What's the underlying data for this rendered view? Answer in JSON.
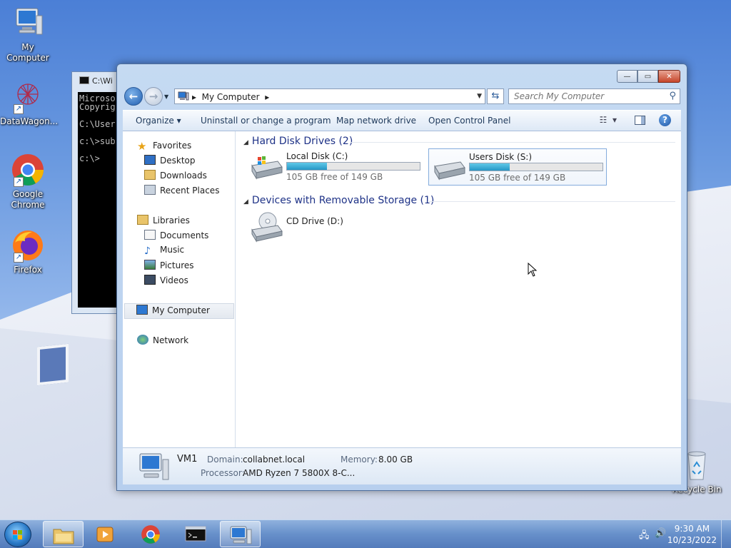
{
  "desktop": {
    "icons": [
      {
        "label": "My Computer",
        "icon": "computer-icon"
      },
      {
        "label": "DataWagon...",
        "icon": "datawagon-icon"
      },
      {
        "label": "Google Chrome",
        "icon": "chrome-icon"
      },
      {
        "label": "Firefox",
        "icon": "firefox-icon"
      },
      {
        "label": "Recycle Bin",
        "icon": "recycle-bin-icon"
      }
    ]
  },
  "console": {
    "title": "C:\\Wi",
    "text": "Microso\nCopyrig\n\nC:\\User\n\nc:\\>sub\n\nc:\\>"
  },
  "explorer": {
    "caption": {
      "minimize": "—",
      "maximize": "▭",
      "close": "✕"
    },
    "address": {
      "crumb": "My Computer"
    },
    "search": {
      "placeholder": "Search My Computer"
    },
    "commands": {
      "organize": "Organize ▾",
      "uninstall": "Uninstall or change a program",
      "map": "Map network drive",
      "control_panel": "Open Control Panel",
      "help": "?"
    },
    "nav": {
      "favorites": "Favorites",
      "desktop": "Desktop",
      "downloads": "Downloads",
      "recent": "Recent Places",
      "libraries": "Libraries",
      "documents": "Documents",
      "music": "Music",
      "pictures": "Pictures",
      "videos": "Videos",
      "computer": "My Computer",
      "network": "Network"
    },
    "groups": {
      "hdd": "Hard Disk Drives (2)",
      "removable": "Devices with Removable Storage (1)"
    },
    "drives": [
      {
        "name": "Local Disk (C:)",
        "free": "105 GB free of 149 GB",
        "used_fraction": 0.3
      },
      {
        "name": "Users Disk (S:)",
        "free": "105 GB free of 149 GB",
        "used_fraction": 0.3
      }
    ],
    "cd": {
      "name": "CD Drive (D:)"
    },
    "details": {
      "name": "VM1",
      "domain_label": "Domain:",
      "domain": "collabnet.local",
      "memory_label": "Memory:",
      "memory": "8.00 GB",
      "processor_label": "Processor:",
      "processor": "AMD Ryzen 7 5800X 8-C..."
    }
  },
  "taskbar": {
    "time": "9:30 AM",
    "date": "10/23/2022"
  }
}
